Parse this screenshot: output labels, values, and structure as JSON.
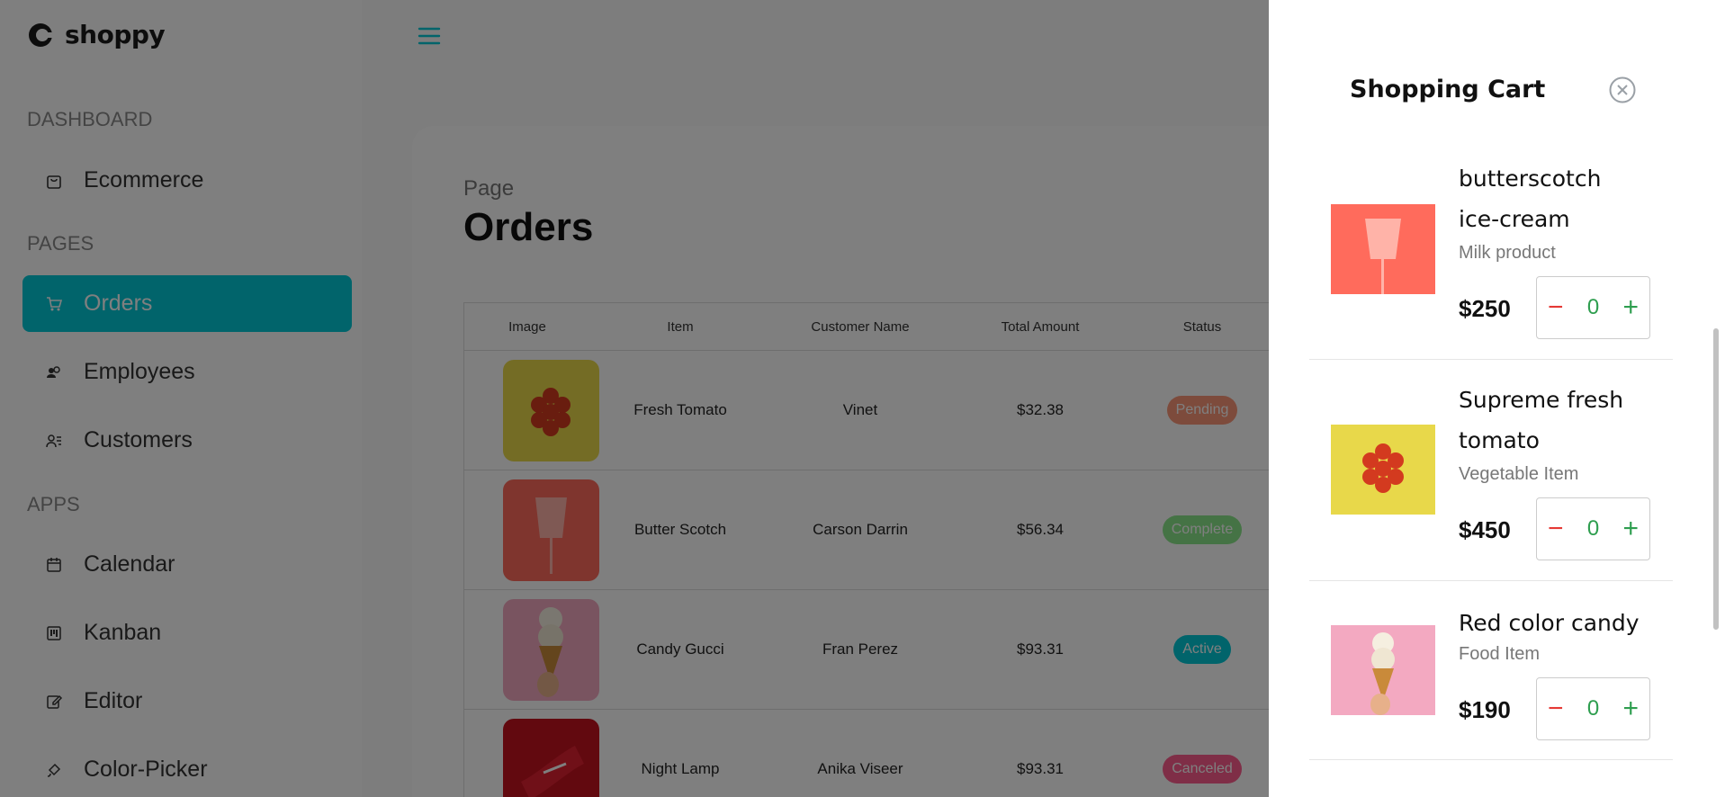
{
  "app": {
    "name": "shoppy"
  },
  "sidebar": {
    "sections": [
      {
        "label": "DASHBOARD"
      },
      {
        "label": "PAGES"
      },
      {
        "label": "APPS"
      }
    ],
    "items": [
      {
        "label": "Ecommerce",
        "icon": "shopping-bag-icon"
      },
      {
        "label": "Orders",
        "icon": "cart-icon",
        "active": true
      },
      {
        "label": "Employees",
        "icon": "employees-icon"
      },
      {
        "label": "Customers",
        "icon": "customers-icon"
      },
      {
        "label": "Calendar",
        "icon": "calendar-icon"
      },
      {
        "label": "Kanban",
        "icon": "kanban-icon"
      },
      {
        "label": "Editor",
        "icon": "edit-icon"
      },
      {
        "label": "Color-Picker",
        "icon": "color-picker-icon"
      }
    ]
  },
  "page": {
    "subtitle": "Page",
    "title": "Orders"
  },
  "table": {
    "headers": [
      "Image",
      "Item",
      "Customer Name",
      "Total Amount",
      "Status"
    ],
    "rows": [
      {
        "item": "Fresh Tomato",
        "customer": "Vinet",
        "amount": "$32.38",
        "status": "Pending",
        "status_color": "#FB9678",
        "image": "tomato"
      },
      {
        "item": "Butter Scotch",
        "customer": "Carson Darrin",
        "amount": "$56.34",
        "status": "Complete",
        "status_color": "#8BE78B",
        "image": "icecream-cup"
      },
      {
        "item": "Candy Gucci",
        "customer": "Fran Perez",
        "amount": "$93.31",
        "status": "Active",
        "status_color": "#03C9D7",
        "image": "cone"
      },
      {
        "item": "Night Lamp",
        "customer": "Anika Viseer",
        "amount": "$93.31",
        "status": "Canceled",
        "status_color": "#FF5C8E",
        "image": "shoe"
      }
    ]
  },
  "cart": {
    "title": "Shopping Cart",
    "items": [
      {
        "name": "butterscotch ice-cream",
        "category": "Milk product",
        "price": "$250",
        "qty": "0",
        "image": "icecream-cup"
      },
      {
        "name": "Supreme fresh tomato",
        "category": "Vegetable Item",
        "price": "$450",
        "qty": "0",
        "image": "tomato"
      },
      {
        "name": "Red color candy",
        "category": "Food Item",
        "price": "$190",
        "qty": "0",
        "image": "cone"
      }
    ],
    "stepper": {
      "minus": "−",
      "plus": "+"
    }
  },
  "colors": {
    "accent": "#03C9D7",
    "overlay": "rgba(0,0,0,0.5)"
  }
}
